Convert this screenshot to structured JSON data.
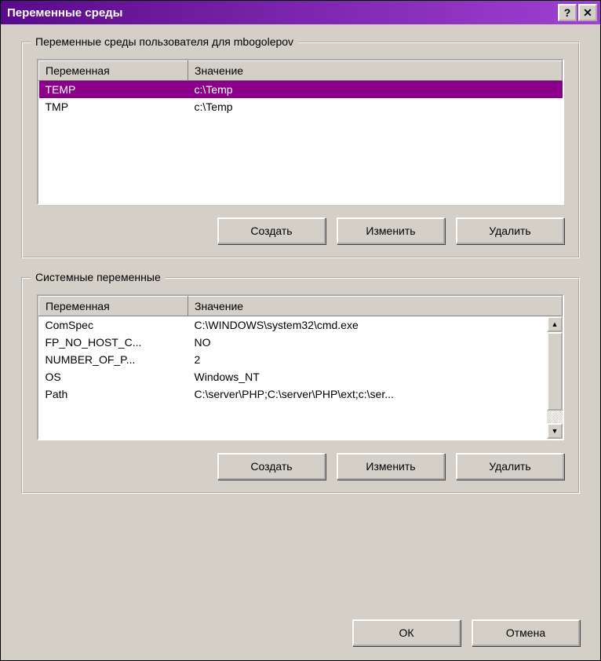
{
  "window": {
    "title": "Переменные среды"
  },
  "userVars": {
    "legend": "Переменные среды пользователя для mbogolepov",
    "columns": {
      "variable": "Переменная",
      "value": "Значение"
    },
    "rows": [
      {
        "name": "TEMP",
        "value": "c:\\Temp",
        "selected": true
      },
      {
        "name": "TMP",
        "value": "c:\\Temp",
        "selected": false
      }
    ],
    "buttons": {
      "new": "Создать",
      "edit": "Изменить",
      "delete": "Удалить"
    }
  },
  "systemVars": {
    "legend": "Системные переменные",
    "columns": {
      "variable": "Переменная",
      "value": "Значение"
    },
    "rows": [
      {
        "name": "ComSpec",
        "value": "C:\\WINDOWS\\system32\\cmd.exe",
        "selected": false
      },
      {
        "name": "FP_NO_HOST_C...",
        "value": "NO",
        "selected": false
      },
      {
        "name": "NUMBER_OF_P...",
        "value": "2",
        "selected": false
      },
      {
        "name": "OS",
        "value": "Windows_NT",
        "selected": false
      },
      {
        "name": "Path",
        "value": "C:\\server\\PHP;C:\\server\\PHP\\ext;c:\\ser...",
        "selected": false
      }
    ],
    "buttons": {
      "new": "Создать",
      "edit": "Изменить",
      "delete": "Удалить"
    }
  },
  "dialog": {
    "ok": "ОК",
    "cancel": "Отмена"
  }
}
